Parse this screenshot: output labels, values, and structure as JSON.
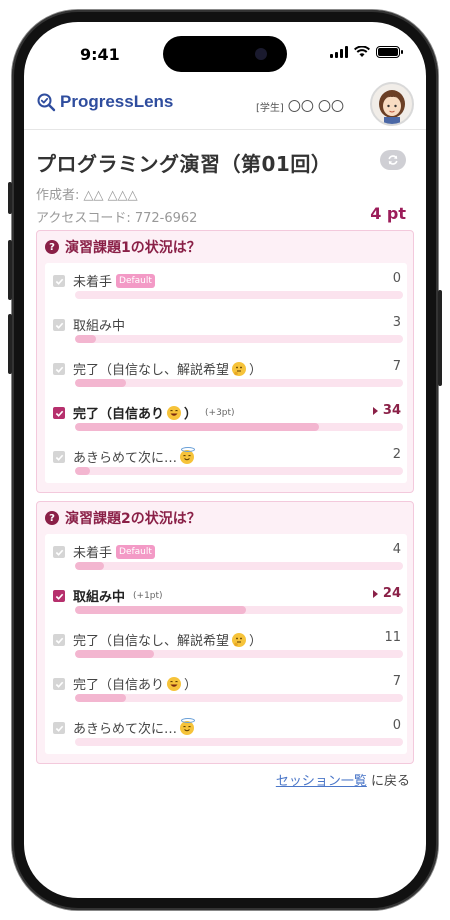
{
  "status_bar": {
    "time": "9:41"
  },
  "header": {
    "brand": "ProgressLens",
    "user_tag": "[学生]",
    "user_name": "〇〇 〇〇"
  },
  "session": {
    "title": "プログラミング演習（第01回）",
    "author": "作成者: △△ △△△",
    "access_code": "アクセスコード: 772-6962",
    "points": "4 pt"
  },
  "questions": [
    {
      "title": "演習課題1の状況は？",
      "options": [
        {
          "label": "未着手",
          "badge": "Default",
          "count": "0",
          "fraction": 0,
          "selected": false
        },
        {
          "label": "取組み中",
          "count": "3",
          "fraction": 0.065,
          "selected": false
        },
        {
          "label": "完了（自信なし、解説希望",
          "label_end": "）",
          "emoji": "thinking-emoji",
          "count": "7",
          "fraction": 0.155,
          "selected": false
        },
        {
          "label": "完了（自信あり",
          "label_end": "）",
          "emoji": "grin-emoji",
          "bonus": "(+3pt)",
          "count": "34",
          "fraction": 0.745,
          "selected": true
        },
        {
          "label": "あきらめて次に…",
          "emoji": "halo-emoji",
          "count": "2",
          "fraction": 0.045,
          "selected": false
        }
      ]
    },
    {
      "title": "演習課題2の状況は？",
      "options": [
        {
          "label": "未着手",
          "badge": "Default",
          "count": "4",
          "fraction": 0.087,
          "selected": false
        },
        {
          "label": "取組み中",
          "bonus": "(+1pt)",
          "count": "24",
          "fraction": 0.52,
          "selected": true
        },
        {
          "label": "完了（自信なし、解説希望",
          "label_end": "）",
          "emoji": "thinking-emoji",
          "count": "11",
          "fraction": 0.24,
          "selected": false
        },
        {
          "label": "完了（自信あり",
          "label_end": "）",
          "emoji": "grin-emoji",
          "count": "7",
          "fraction": 0.155,
          "selected": false
        },
        {
          "label": "あきらめて次に…",
          "emoji": "halo-emoji",
          "count": "0",
          "fraction": 0,
          "selected": false
        }
      ]
    }
  ],
  "footer": {
    "link_text": "セッション一覧",
    "suffix": "に戻る"
  },
  "colors": {
    "accent": "#8a2047",
    "brand": "#2f4d9e",
    "bar_fill": "#f3b6d0",
    "bar_track": "#fbe3ee"
  }
}
